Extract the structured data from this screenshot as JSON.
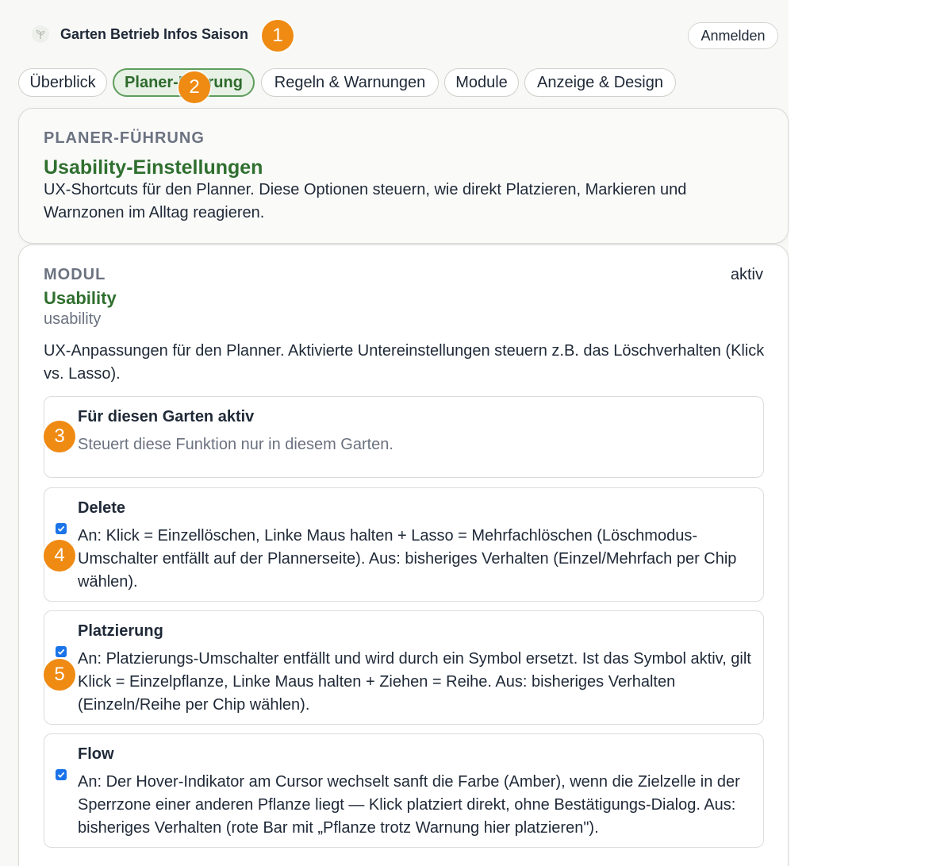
{
  "header": {
    "brand_title": "Garten Betrieb Infos Saison",
    "login_label": "Anmelden"
  },
  "tabs": [
    {
      "label": "Überblick",
      "active": false
    },
    {
      "label": "Planer-Führung",
      "active": true
    },
    {
      "label": "Regeln & Warnungen",
      "active": false
    },
    {
      "label": "Module",
      "active": false
    },
    {
      "label": "Anzeige & Design",
      "active": false
    }
  ],
  "intro": {
    "eyebrow": "PLANER-FÜHRUNG",
    "title": "Usability-Einstellungen",
    "description": "UX-Shortcuts für den Planner. Diese Optionen steuern, wie direkt Platzieren, Markieren und Warnzonen im Alltag reagieren."
  },
  "module": {
    "eyebrow": "MODUL",
    "title": "Usability",
    "slug": "usability",
    "status": "aktiv",
    "description": "UX-Anpassungen für den Planner. Aktivierte Untereinstellungen steuern z.B. das Löschverhalten (Klick vs. Lasso).",
    "settings": [
      {
        "title": "Für diesen Garten aktiv",
        "description": "Steuert diese Funktion nur in diesem Garten.",
        "checked": false
      },
      {
        "title": "Delete",
        "description": "An: Klick = Einzellöschen, Linke Maus halten + Lasso = Mehrfachlöschen (Löschmodus-Umschalter entfällt auf der Plannerseite). Aus: bisheriges Verhalten (Einzel/Mehrfach per Chip wählen).",
        "checked": true
      },
      {
        "title": "Platzierung",
        "description": "An: Platzierungs-Umschalter entfällt und wird durch ein Symbol ersetzt. Ist das Symbol aktiv, gilt Klick = Einzelpflanze, Linke Maus halten + Ziehen = Reihe. Aus: bisheriges Verhalten (Einzeln/Reihe per Chip wählen).",
        "checked": true
      },
      {
        "title": "Flow",
        "description": "An: Der Hover-Indikator am Cursor wechselt sanft die Farbe (Amber), wenn die Zielzelle in der Sperrzone einer anderen Pflanze liegt — Klick platziert direkt, ohne Bestätigungs-Dialog. Aus: bisheriges Verhalten (rote Bar mit „Pflanze trotz Warnung hier platzieren\").",
        "checked": true
      }
    ]
  },
  "markers": [
    "1",
    "2",
    "3",
    "4",
    "5"
  ],
  "colors": {
    "accent_green": "#2f6f2f",
    "active_tab_bg": "#e7f1e5",
    "marker_orange": "#ef8a12",
    "checkbox_blue": "#1a73e8"
  },
  "icons": {
    "brand": "sprout-icon",
    "checkbox": "check-icon"
  }
}
